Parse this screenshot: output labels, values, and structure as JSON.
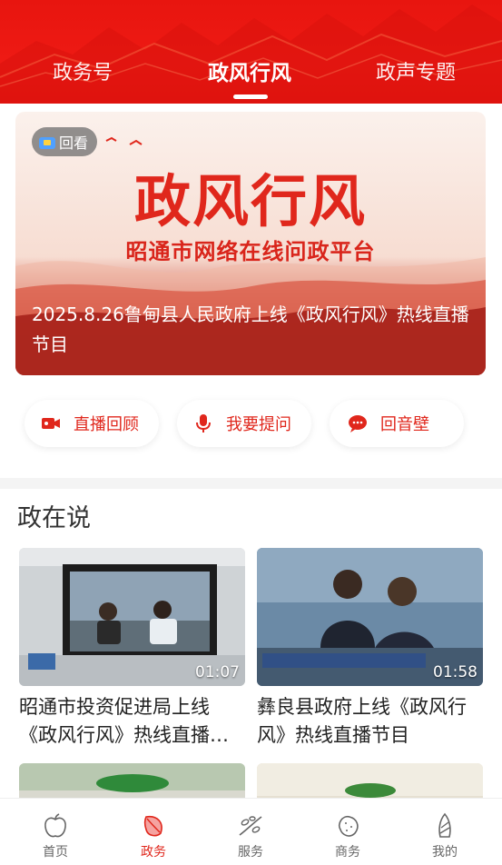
{
  "header": {
    "tabs": [
      {
        "label": "政务号"
      },
      {
        "label": "政风行风"
      },
      {
        "label": "政声专题"
      }
    ],
    "active_tab": 1
  },
  "banner": {
    "badge": "回看",
    "title": "政风行风",
    "subtitle": "昭通市网络在线问政平台",
    "caption": "2025.8.26鲁甸县人民政府上线《政风行风》热线直播节目"
  },
  "actions": [
    {
      "label": "直播回顾",
      "icon": "video-camera-icon"
    },
    {
      "label": "我要提问",
      "icon": "microphone-icon"
    },
    {
      "label": "回音壁",
      "icon": "chat-bubble-icon"
    }
  ],
  "section": {
    "title": "政在说",
    "cards": [
      {
        "title": "昭通市投资促进局上线《政风行风》热线直播节目",
        "duration": "01:07"
      },
      {
        "title": "彝良县政府上线《政风行风》热线直播节目",
        "duration": "01:58"
      },
      {
        "title": "",
        "duration": ""
      },
      {
        "title": "",
        "duration": ""
      }
    ]
  },
  "bottom_nav": [
    {
      "label": "首页",
      "icon": "apple-icon"
    },
    {
      "label": "政务",
      "icon": "leaf-icon"
    },
    {
      "label": "服务",
      "icon": "branch-icon"
    },
    {
      "label": "商务",
      "icon": "potato-icon"
    },
    {
      "label": "我的",
      "icon": "bamboo-shoot-icon"
    }
  ],
  "colors": {
    "brand_red": "#e0271c",
    "header_red": "#ee1a14"
  }
}
